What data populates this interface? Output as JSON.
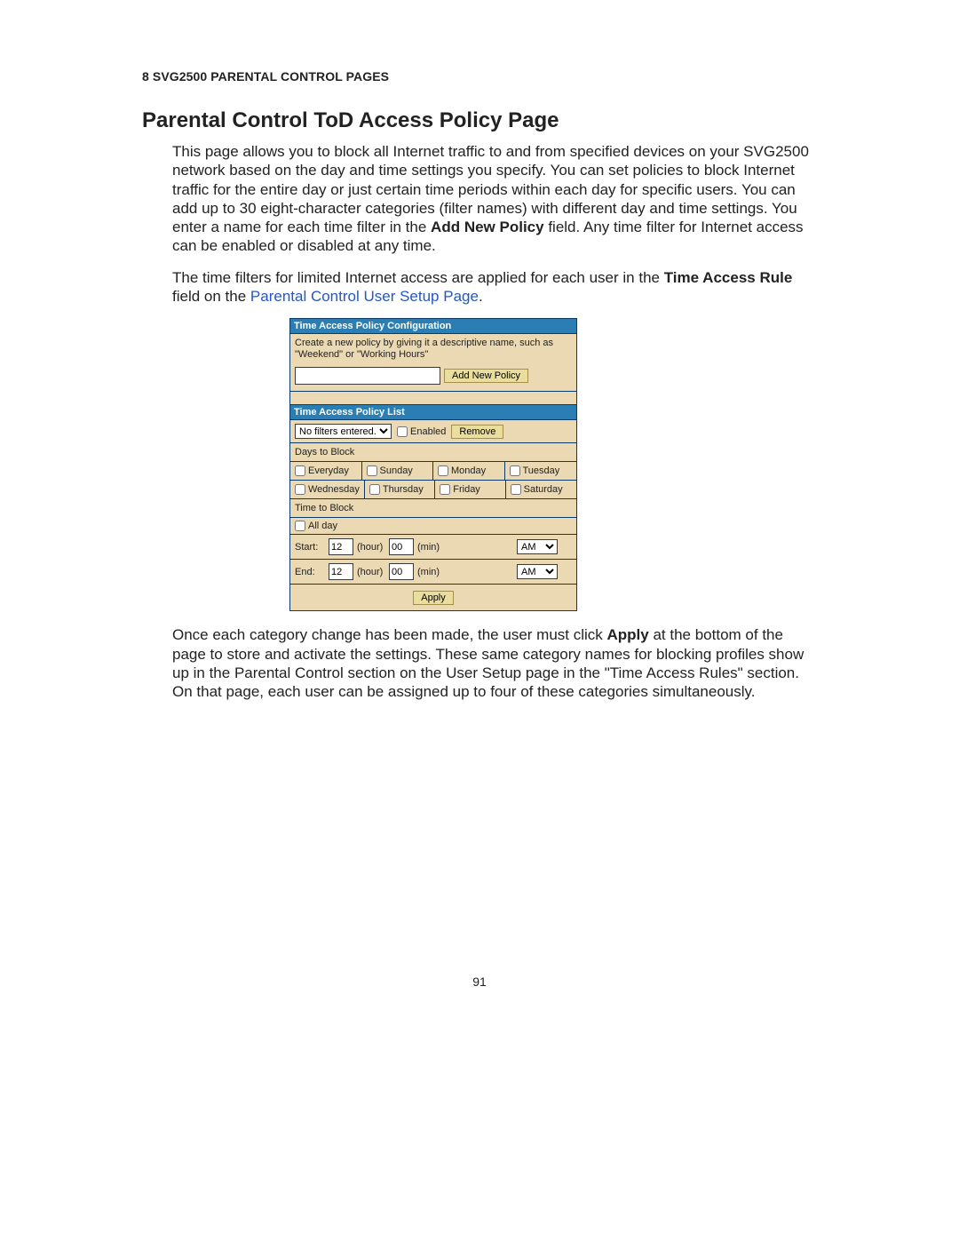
{
  "doc": {
    "section_header": "8 SVG2500 PARENTAL CONTROL PAGES",
    "page_title": "Parental Control ToD Access Policy Page",
    "p1_part1": "This page allows you to block all Internet traffic to and from specified devices on your SVG2500 network based on the day and time settings you specify. You can set policies to block Internet traffic for the entire day or just certain time periods within each day for specific users. You can add up to 30 eight-character categories (filter names) with different day and time settings. You enter a name for each time filter in the ",
    "p1_bold": "Add New Policy",
    "p1_part2": " field. Any time filter for Internet access can be enabled or disabled at any time.",
    "p2_part1": "The time filters for limited Internet access are applied for each user in the ",
    "p2_bold": "Time Access Rule",
    "p2_part2": " field on the ",
    "p2_link": "Parental Control User Setup Page",
    "p2_part3": ".",
    "p3_part1": "Once each category change has been made, the user must click ",
    "p3_bold": "Apply",
    "p3_part2": " at the bottom of the page to store and activate the settings. These same category names for blocking profiles show up in the Parental Control section on the User Setup page in the \"Time Access Rules\" section. On that page, each user can be assigned up to four of these categories simultaneously.",
    "page_number": "91"
  },
  "panel": {
    "config_header": "Time Access Policy Configuration",
    "instructions": "Create a new policy by giving it a descriptive name, such as \"Weekend\" or \"Working Hours\"",
    "add_button": "Add New Policy",
    "list_header": "Time Access Policy List",
    "filter_select": "No filters entered.",
    "enabled_label": "Enabled",
    "remove_button": "Remove",
    "days_header": "Days to Block",
    "days": {
      "everyday": "Everyday",
      "sunday": "Sunday",
      "monday": "Monday",
      "tuesday": "Tuesday",
      "wednesday": "Wednesday",
      "thursday": "Thursday",
      "friday": "Friday",
      "saturday": "Saturday"
    },
    "time_header": "Time to Block",
    "all_day_label": "All day",
    "start_label": "Start:",
    "end_label": "End:",
    "hour_label": "(hour)",
    "min_label": "(min)",
    "start_hour": "12",
    "start_min": "00",
    "start_ampm": "AM",
    "end_hour": "12",
    "end_min": "00",
    "end_ampm": "AM",
    "apply_button": "Apply"
  }
}
